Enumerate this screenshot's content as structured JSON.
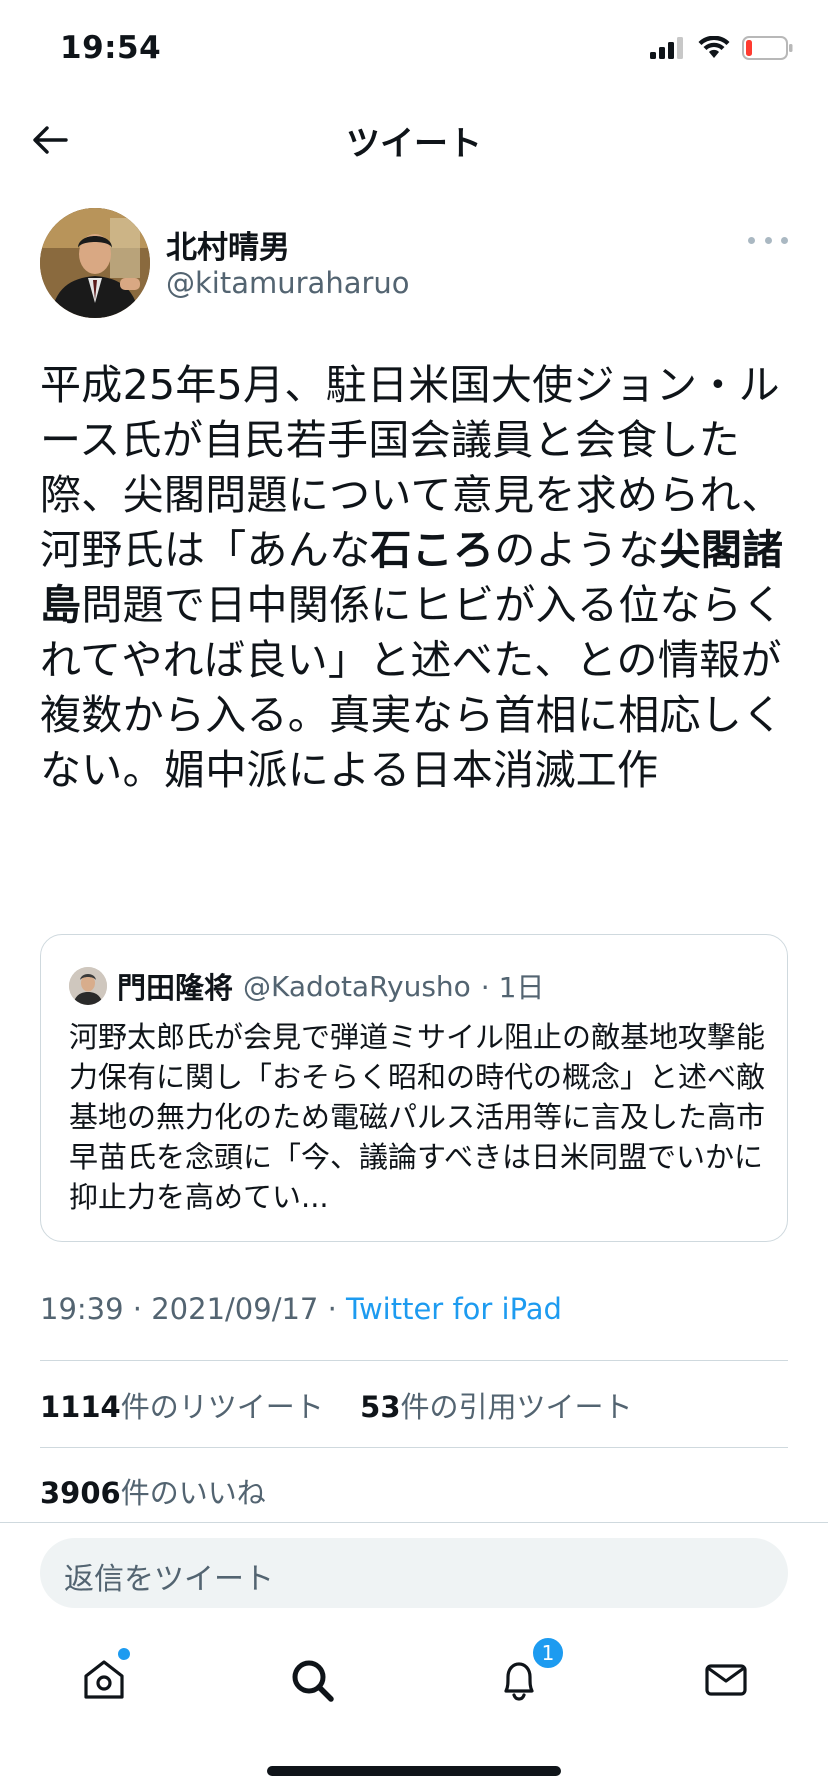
{
  "status_bar": {
    "time": "19:54",
    "icons": [
      "signal-icon",
      "wifi-icon",
      "battery-low-icon"
    ],
    "battery_color": "#ff3b30"
  },
  "header": {
    "title": "ツイート",
    "back_icon": "back-arrow-icon"
  },
  "tweet": {
    "author": {
      "display_name": "北村晴男",
      "handle": "@kitamuraharuo"
    },
    "text": {
      "part1": "平成25年5月、駐日米国大使ジョン・ルース氏が自民若手国会議員と会食した際、尖閣問題について意見を求められ、河野氏は「あんな",
      "bold1": "石ころ",
      "part2": "のような",
      "bold2": "尖閣諸島",
      "part3": "問題で日中関係にヒビが入る位ならくれてやれば良い」と述べた、との情報が複数から入る。真実なら首相に相応しくない。媚中派による日本消滅工作"
    },
    "quote": {
      "display_name": "門田隆将",
      "handle": "@KadotaRyusho",
      "time": "· 1日",
      "text": "河野太郎氏が会見で弾道ミサイル阻止の敵基地攻撃能力保有に関し「おそらく昭和の時代の概念」と述べ敵基地の無力化のため電磁パルス活用等に言及した高市早苗氏を念頭に「今、議論すべきは日米同盟でいかに抑止力を高めてい..."
    },
    "timestamp": "19:39 · 2021/09/17 · ",
    "source": "Twitter for iPad",
    "stats": {
      "retweets_count": "1114",
      "retweets_label": "件のリツイート",
      "quotes_count": "53",
      "quotes_label": "件の引用ツイート",
      "likes_count": "3906",
      "likes_label": "件のいいね"
    }
  },
  "reply": {
    "placeholder": "返信をツイート"
  },
  "tabbar": {
    "items": [
      "home-icon",
      "search-icon",
      "notifications-icon",
      "messages-icon"
    ],
    "notification_badge": "1",
    "accent_color": "#1d9bf0"
  }
}
